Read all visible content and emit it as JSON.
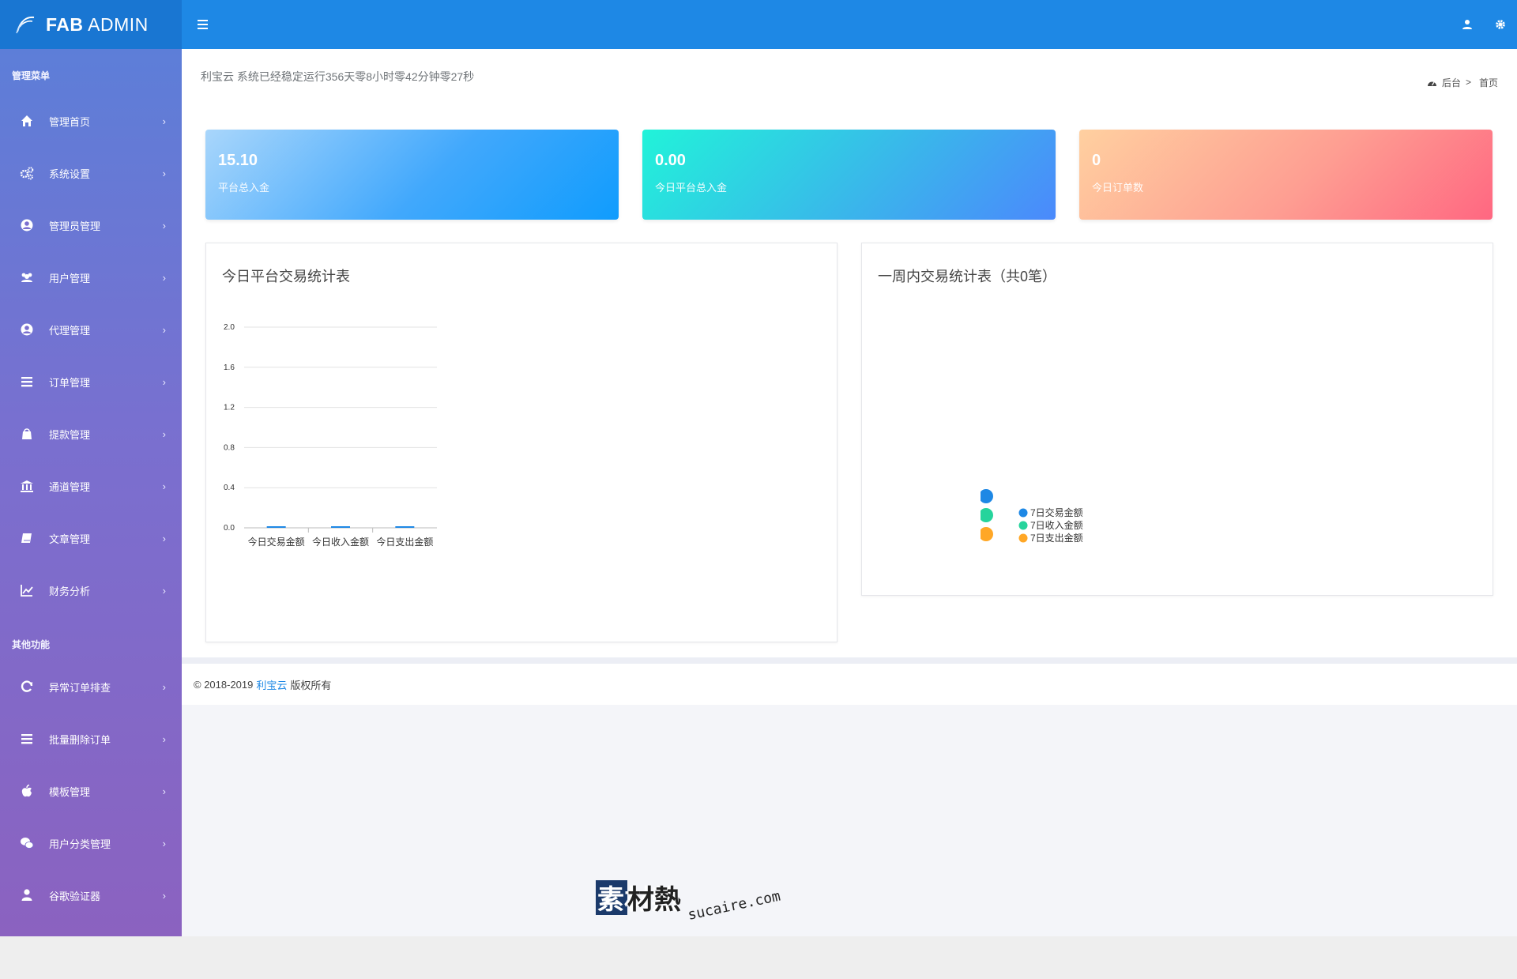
{
  "brand": {
    "name_bold": "FAB",
    "name_rest": " ADMIN"
  },
  "header": {
    "user_icon": "user-icon",
    "settings_icon": "gear-icon",
    "menu_icon": "hamburger-icon"
  },
  "sidebar": {
    "section1_title": "管理菜单",
    "items1": [
      {
        "label": "管理首页",
        "icon": "home-icon"
      },
      {
        "label": "系统设置",
        "icon": "cogs-icon"
      },
      {
        "label": "管理员管理",
        "icon": "user-circle-icon"
      },
      {
        "label": "用户管理",
        "icon": "users-icon"
      },
      {
        "label": "代理管理",
        "icon": "user-circle-icon"
      },
      {
        "label": "订单管理",
        "icon": "list-icon"
      },
      {
        "label": "提款管理",
        "icon": "bag-icon"
      },
      {
        "label": "通道管理",
        "icon": "bank-icon"
      },
      {
        "label": "文章管理",
        "icon": "book-icon"
      },
      {
        "label": "财务分析",
        "icon": "line-chart-icon"
      }
    ],
    "section2_title": "其他功能",
    "items2": [
      {
        "label": "异常订单排查",
        "icon": "refresh-icon"
      },
      {
        "label": "批量删除订单",
        "icon": "list-icon"
      },
      {
        "label": "模板管理",
        "icon": "apple-icon"
      },
      {
        "label": "用户分类管理",
        "icon": "wechat-icon"
      },
      {
        "label": "谷歌验证器",
        "icon": "user-icon"
      }
    ]
  },
  "pagebar": {
    "uptime": "利宝云 系统已经稳定运行356天零8小时零42分钟零27秒",
    "breadcrumb_root": "后台",
    "breadcrumb_sep": ">",
    "breadcrumb_current": "首页"
  },
  "stats": [
    {
      "value": "15.10",
      "label": "平台总入金"
    },
    {
      "value": "0.00",
      "label": "今日平台总入金"
    },
    {
      "value": "0",
      "label": "今日订单数"
    }
  ],
  "chart_today": {
    "title": "今日平台交易统计表"
  },
  "chart_week": {
    "title": "一周内交易统计表（共0笔）"
  },
  "chart_data": [
    {
      "type": "bar",
      "title": "今日平台交易统计表",
      "categories": [
        "今日交易金额",
        "今日收入金额",
        "今日支出金额"
      ],
      "values": [
        0,
        0,
        0
      ],
      "yticks": [
        "2.0",
        "1.6",
        "1.2",
        "0.8",
        "0.4",
        "0.0"
      ],
      "ylim": [
        0,
        2.0
      ],
      "xlabel": "",
      "ylabel": "",
      "grid": true,
      "color": "#1e88e5"
    },
    {
      "type": "pie",
      "title": "一周内交易统计表（共0笔）",
      "labels": [
        "7日交易金额",
        "7日收入金额",
        "7日支出金额"
      ],
      "values": [
        0,
        0,
        0
      ],
      "colors": [
        "#1e88e5",
        "#26d49c",
        "#ffa726"
      ],
      "legend": "right"
    }
  ],
  "footer": {
    "copyright": "© 2018-2019",
    "company": "利宝云",
    "rights": "版权所有"
  },
  "watermark": {
    "cn": "素材熱",
    "latin": "sucaire.com"
  }
}
